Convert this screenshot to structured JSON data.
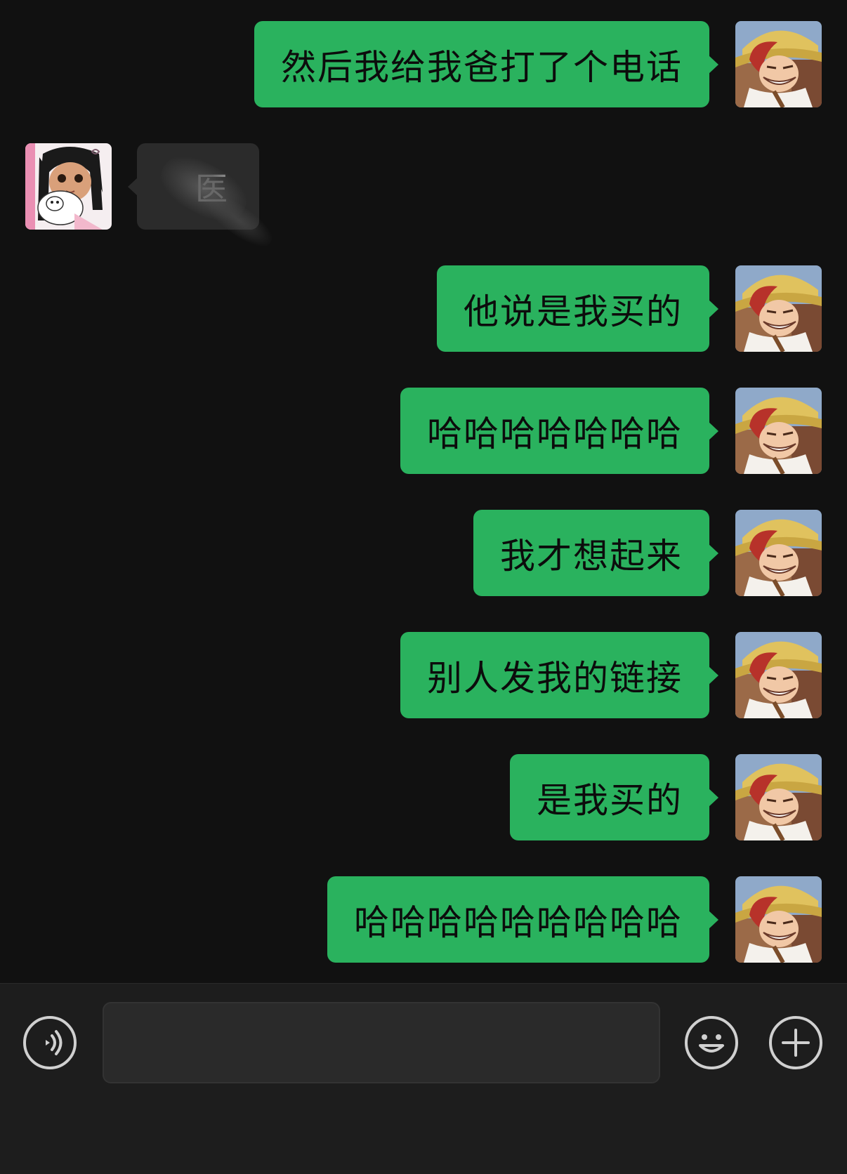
{
  "colors": {
    "background": "#111111",
    "my_bubble": "#2ab25e",
    "their_bubble": "#2b2b2b",
    "input_bar": "#1d1d1d"
  },
  "avatars": {
    "me": "anime-straw-hat-red-hair-avatar-icon",
    "them": "cartoon-girl-with-lamb-avatar-icon"
  },
  "messages": [
    {
      "sender": "me",
      "text": "然后我给我爸打了个电话"
    },
    {
      "sender": "them",
      "text": "医"
    },
    {
      "sender": "me",
      "text": "他说是我买的"
    },
    {
      "sender": "me",
      "text": "哈哈哈哈哈哈哈"
    },
    {
      "sender": "me",
      "text": "我才想起来"
    },
    {
      "sender": "me",
      "text": "别人发我的链接"
    },
    {
      "sender": "me",
      "text": "是我买的"
    },
    {
      "sender": "me",
      "text": "哈哈哈哈哈哈哈哈哈"
    }
  ],
  "input_bar": {
    "voice_icon": "voice-input-icon",
    "text_value": "",
    "emoji_icon": "emoji-icon",
    "plus_icon": "plus-icon"
  }
}
